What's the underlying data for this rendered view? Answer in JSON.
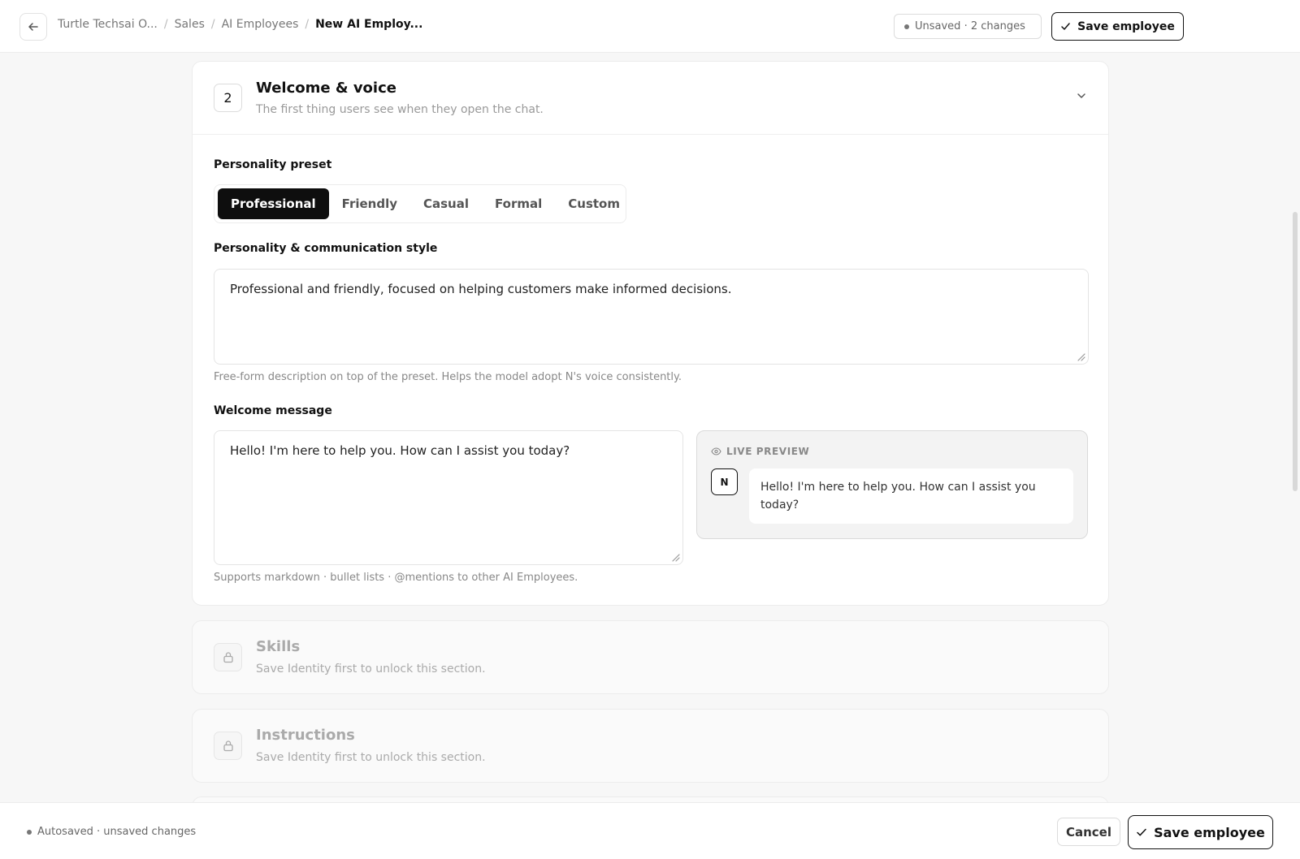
{
  "topbar": {
    "breadcrumb": [
      "Turtle Techsai O...",
      "Sales",
      "AI Employees"
    ],
    "breadcrumb_current": "New AI Employ...",
    "unsaved_label": "Unsaved · 2 changes",
    "save_label": "Save employee"
  },
  "section": {
    "number": "2",
    "title": "Welcome & voice",
    "subtitle": "The first thing users see when they open the chat."
  },
  "personality": {
    "preset_label": "Personality preset",
    "presets": [
      "Professional",
      "Friendly",
      "Casual",
      "Formal",
      "Custom"
    ],
    "selected": "Professional",
    "style_label": "Personality & communication style",
    "style_value": "Professional and friendly, focused on helping customers make informed decisions.",
    "style_hint": "Free-form description on top of the preset. Helps the model adopt N's voice consistently."
  },
  "welcome": {
    "label": "Welcome message",
    "value": "Hello! I'm here to help you. How can I assist you today?",
    "hint": "Supports markdown · bullet lists · @mentions to other AI Employees.",
    "preview_label": "LIVE PREVIEW",
    "avatar": "N",
    "preview_text": "Hello! I'm here to help you. How can I assist you today?"
  },
  "locked_sections": [
    {
      "title": "Skills",
      "subtitle": "Save Identity first to unlock this section."
    },
    {
      "title": "Instructions",
      "subtitle": "Save Identity first to unlock this section."
    }
  ],
  "footer": {
    "autosave": "Autosaved · unsaved changes",
    "cancel_label": "Cancel",
    "save_label": "Save employee"
  },
  "icons": [
    "arrow-left-icon",
    "check-icon",
    "chevron-down-icon",
    "eye-icon",
    "lock-icon",
    "resize-handle-icon"
  ],
  "colors": {
    "accent": "#0e0e0e",
    "muted": "#888888",
    "background": "#f7f7f7"
  }
}
